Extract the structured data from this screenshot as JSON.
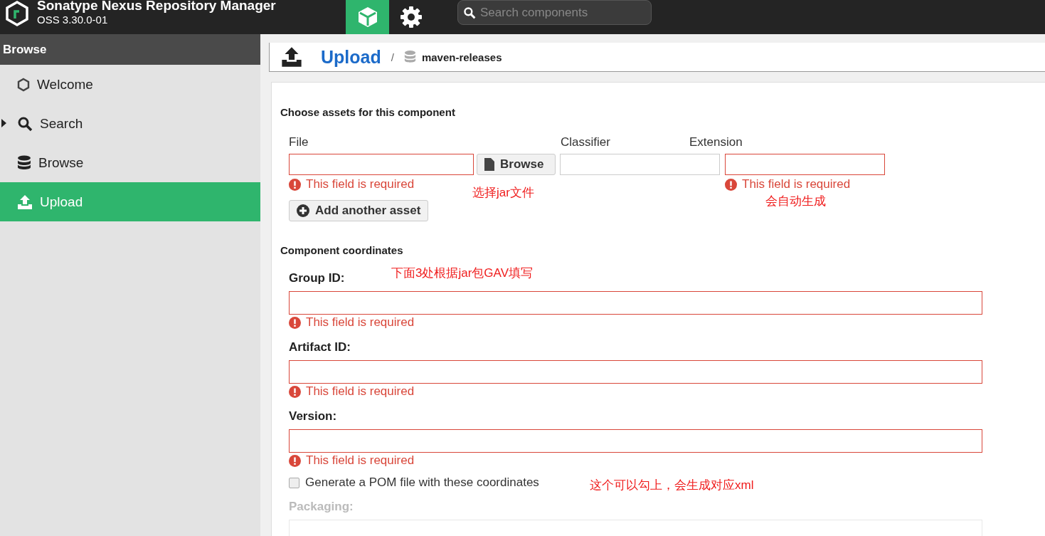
{
  "app": {
    "title": "Sonatype Nexus Repository Manager",
    "version": "OSS 3.30.0-01"
  },
  "topbar": {
    "tabs": [
      {
        "kind": "browse",
        "selected": true
      },
      {
        "kind": "admin",
        "selected": false
      }
    ],
    "search": {
      "placeholder": "Search components"
    }
  },
  "sidebar": {
    "title": "Browse",
    "items": [
      {
        "label": "Welcome",
        "selected": false,
        "expandable": false
      },
      {
        "label": "Search",
        "selected": false,
        "expandable": true
      },
      {
        "label": "Browse",
        "selected": false,
        "expandable": false
      },
      {
        "label": "Upload",
        "selected": true,
        "expandable": false
      }
    ]
  },
  "breadcrumb": {
    "title": "Upload",
    "separator": "/",
    "repository": "maven-releases"
  },
  "assets": {
    "heading": "Choose assets for this component",
    "file": {
      "label": "File",
      "invalid": true,
      "error": "This field is required"
    },
    "browse_button": "Browse",
    "classifier": {
      "label": "Classifier",
      "invalid": false
    },
    "extension": {
      "label": "Extension",
      "invalid": true,
      "error": "This field is required"
    },
    "add_button": "Add another asset"
  },
  "coordinates": {
    "heading": "Component coordinates",
    "fields": [
      {
        "label": "Group ID:",
        "invalid": true,
        "error": "This field is required",
        "disabled": false
      },
      {
        "label": "Artifact ID:",
        "invalid": true,
        "error": "This field is required",
        "disabled": false
      },
      {
        "label": "Version:",
        "invalid": true,
        "error": "This field is required",
        "disabled": false
      }
    ],
    "pom_checkbox": {
      "label": "Generate a POM file with these coordinates",
      "checked": false
    },
    "packaging": {
      "label": "Packaging:",
      "disabled": true
    }
  },
  "annotations": [
    {
      "text": "选择jar文件"
    },
    {
      "text": "会自动生成"
    },
    {
      "text": "下面3处根据jar包GAV填写"
    },
    {
      "text": "这个可以勾上，会生成对应xml"
    }
  ]
}
